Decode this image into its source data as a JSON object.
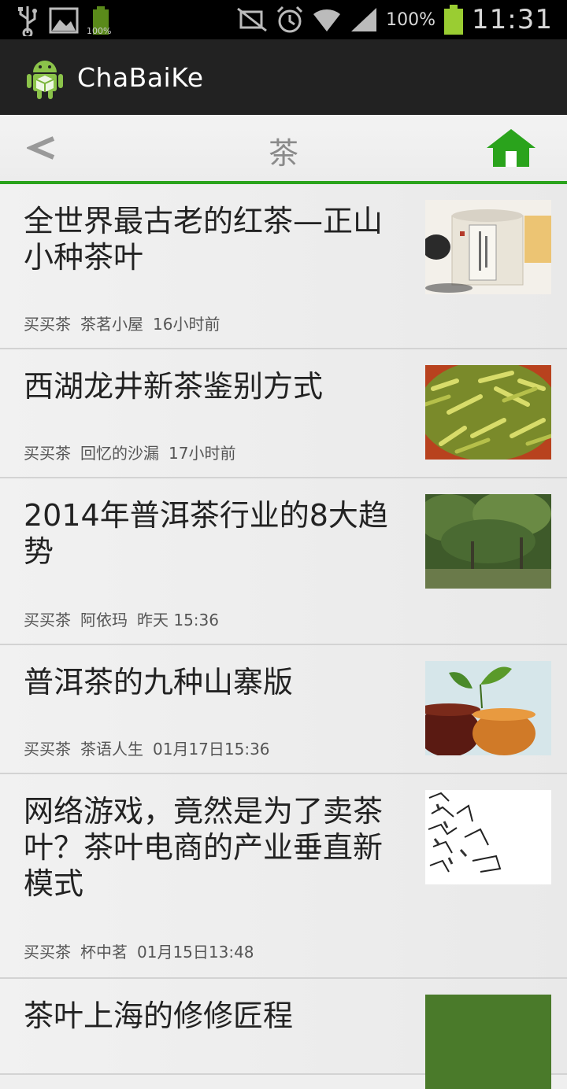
{
  "status_bar": {
    "time": "11:31",
    "battery_percent": "100%",
    "small_battery_label": "100%"
  },
  "action_bar": {
    "app_title": "ChaBaiKe",
    "app_icon": "android-robot-icon"
  },
  "nav": {
    "title": "茶",
    "back_icon": "chevron-left-icon",
    "home_icon": "home-icon",
    "accent": "#2aa31c"
  },
  "articles": [
    {
      "title": "全世界最古老的红茶—正山小种茶叶",
      "source": "买买茶",
      "author": "茶茗小屋",
      "time": "16小时前",
      "thumb": "tea-tin-thumbnail"
    },
    {
      "title": "西湖龙井新茶鉴别方式",
      "source": "买买茶",
      "author": "回忆的沙漏",
      "time": "17小时前",
      "thumb": "green-tea-leaves-thumbnail"
    },
    {
      "title": "2014年普洱茶行业的8大趋势",
      "source": "买买茶",
      "author": "阿依玛",
      "time": "昨天 15:36",
      "thumb": "tea-trees-thumbnail"
    },
    {
      "title": "普洱茶的九种山寨版",
      "source": "买买茶",
      "author": "茶语人生",
      "time": "01月17日15:36",
      "thumb": "tea-cups-thumbnail"
    },
    {
      "title": "网络游戏，竟然是为了卖茶叶？茶叶电商的产业垂直新模式",
      "source": "买买茶",
      "author": "杯中茗",
      "time": "01月15日13:48",
      "thumb": "ink-sketch-thumbnail"
    },
    {
      "title": "茶叶上海的修修匠程",
      "source": "",
      "author": "",
      "time": "",
      "thumb": "green-thumbnail"
    }
  ]
}
